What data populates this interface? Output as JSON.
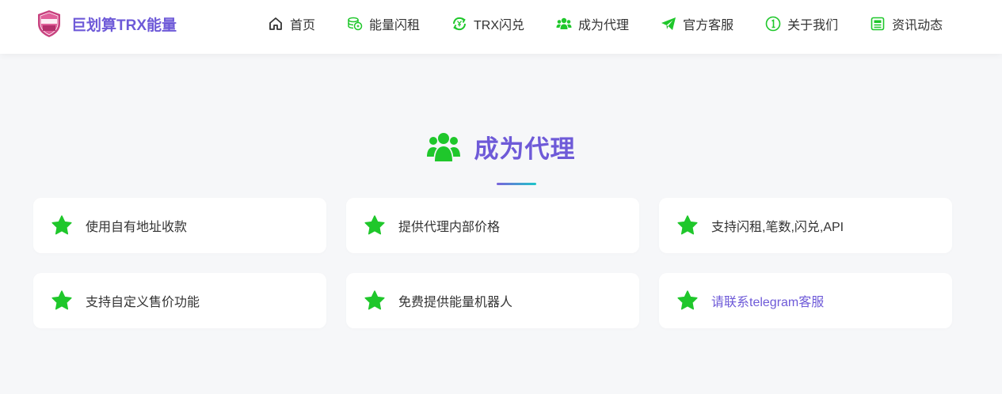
{
  "brand": {
    "logo_text": "巨划算 TRX",
    "name": "巨划算TRX能量"
  },
  "nav": {
    "items": [
      {
        "label": "首页",
        "icon": "home-icon"
      },
      {
        "label": "能量闪租",
        "icon": "coins-icon"
      },
      {
        "label": "TRX闪兑",
        "icon": "exchange-icon"
      },
      {
        "label": "成为代理",
        "icon": "users-icon"
      },
      {
        "label": "官方客服",
        "icon": "paper-plane-icon"
      },
      {
        "label": "关于我们",
        "icon": "info-icon"
      },
      {
        "label": "资讯动态",
        "icon": "news-icon"
      }
    ]
  },
  "section": {
    "title": "成为代理",
    "icon": "users-icon"
  },
  "features": [
    {
      "text": "使用自有地址收款",
      "icon": "star-icon"
    },
    {
      "text": "提供代理内部价格",
      "icon": "star-icon"
    },
    {
      "text": "支持闪租,笔数,闪兑,API",
      "icon": "star-icon"
    },
    {
      "text": "支持自定义售价功能",
      "icon": "star-icon"
    },
    {
      "text": "免费提供能量机器人",
      "icon": "star-icon"
    },
    {
      "text": "请联系telegram客服",
      "icon": "star-icon"
    }
  ],
  "colors": {
    "accent": "#6e5ad8",
    "icon_green": "#1fc72b",
    "page_bg": "#f6f7f9"
  }
}
